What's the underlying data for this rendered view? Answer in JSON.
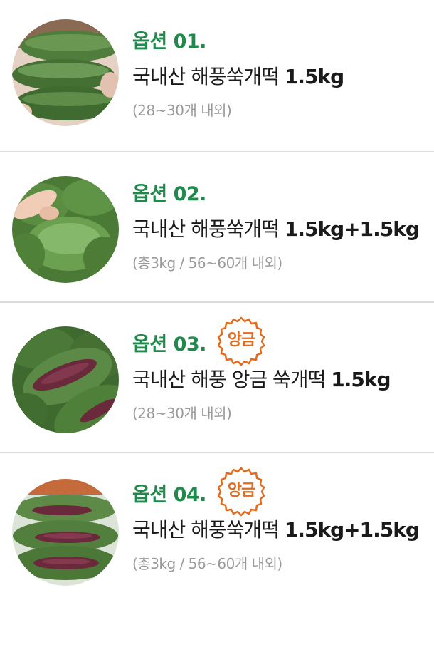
{
  "options": [
    {
      "label": "옵션 01.",
      "name": "국내산 해풍쑥개떡",
      "weight": "1.5kg",
      "note": "(28~30개 내외)",
      "badge": null
    },
    {
      "label": "옵션 02.",
      "name": "국내산 해풍쑥개떡",
      "weight": "1.5kg+1.5kg",
      "note": "(총3kg / 56~60개 내외)",
      "badge": null
    },
    {
      "label": "옵션 03.",
      "name": "국내산 해풍 앙금 쑥개떡",
      "weight": "1.5kg",
      "note": "(28~30개 내외)",
      "badge": "앙금"
    },
    {
      "label": "옵션 04.",
      "name": "국내산 해풍쑥개떡",
      "weight": "1.5kg+1.5kg",
      "note": "(총3kg / 56~60개 내외)",
      "badge": "앙금"
    }
  ],
  "colors": {
    "label_green": "#1f8a4c",
    "badge_orange": "#e36b1c",
    "note_gray": "#9a9a9a",
    "divider": "#dcdcdc",
    "rice_cake_green": "#4e7a3a",
    "red_bean": "#6b2a3c"
  }
}
